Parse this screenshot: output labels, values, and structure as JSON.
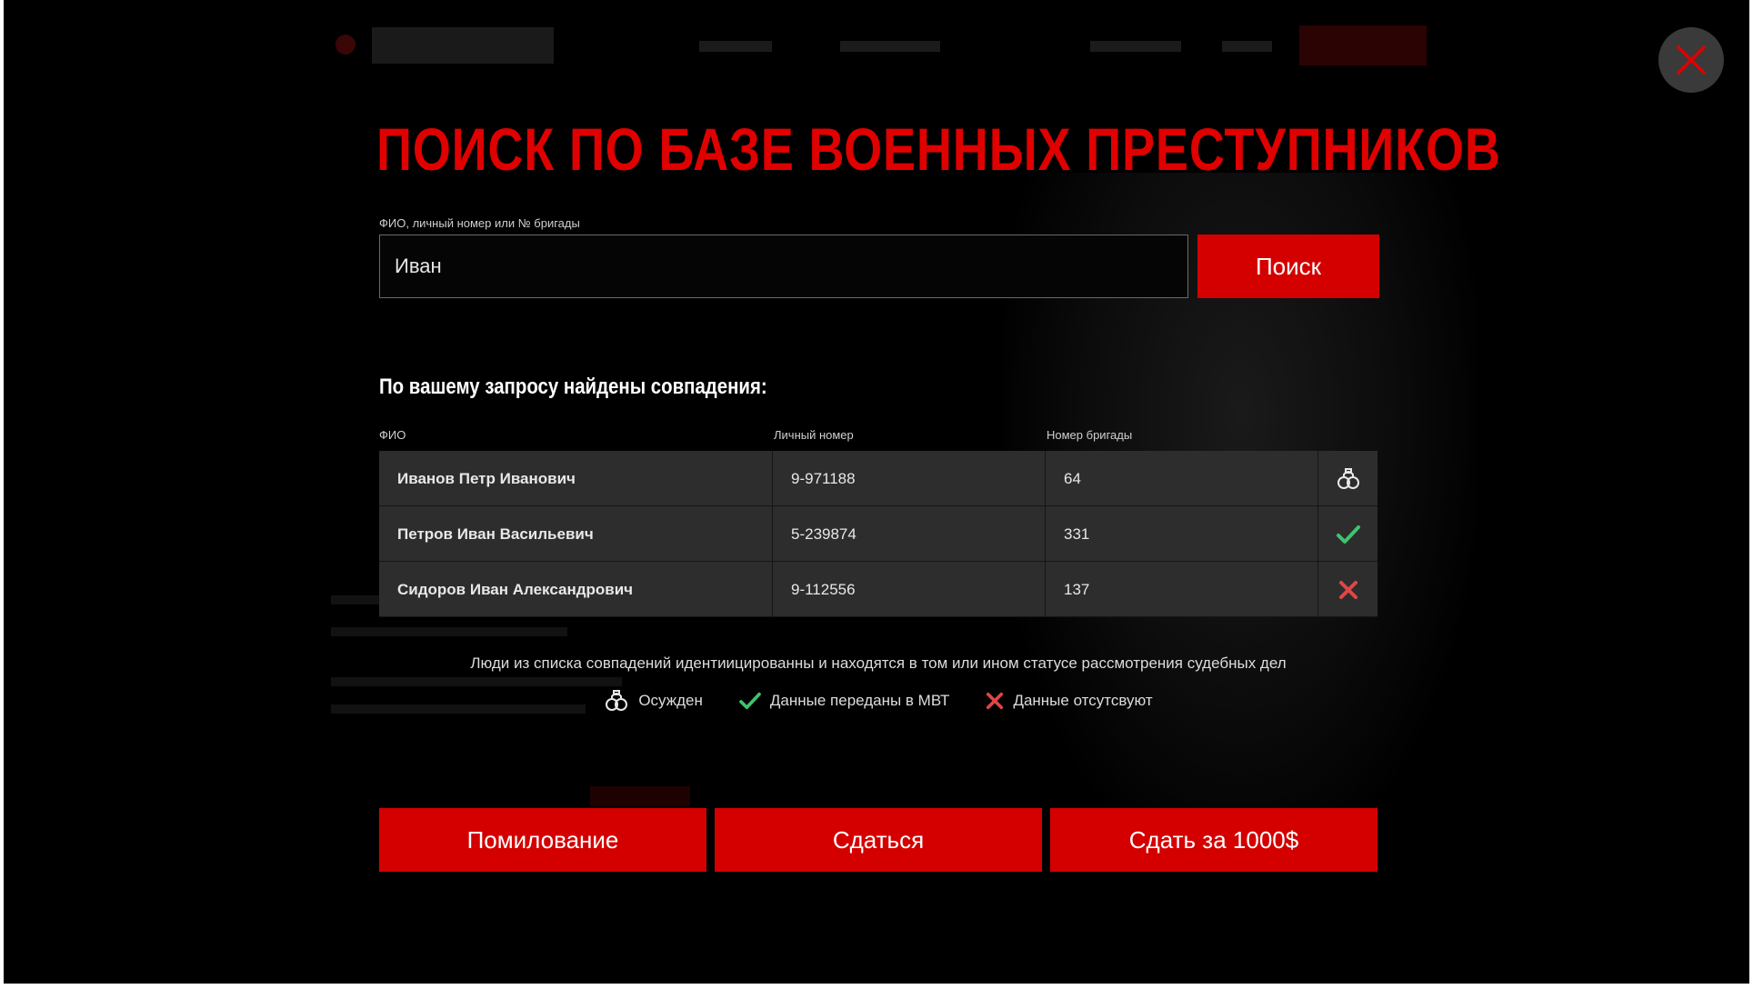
{
  "dialog": {
    "title": "ПОИСК ПО БАЗЕ ВОЕННЫХ ПРЕСТУПНИКОВ",
    "close_icon": "close-icon"
  },
  "search": {
    "label": "ФИО, личный номер или № бригады",
    "value": "Иван",
    "button_label": "Поиск"
  },
  "results": {
    "heading": "По вашему запросу найдены совпадения:",
    "columns": [
      "ФИО",
      "Личный номер",
      "Номер бригады"
    ],
    "rows": [
      {
        "name": "Иванов Петр Иванович",
        "number": "9-971188",
        "brigade": "64",
        "status_icon": "handcuffs-icon"
      },
      {
        "name": "Петров Иван Васильевич",
        "number": "5-239874",
        "brigade": "331",
        "status_icon": "check-icon"
      },
      {
        "name": "Сидоров Иван Александрович",
        "number": "9-112556",
        "brigade": "137",
        "status_icon": "cross-icon"
      }
    ]
  },
  "note": "Люди из списка совпадений идентиицированны и находятся в том или ином статусе рассмотрения судебных дел",
  "legend": [
    {
      "icon": "handcuffs-icon",
      "label": "Осужден"
    },
    {
      "icon": "check-icon",
      "label": "Данные переданы в МВТ"
    },
    {
      "icon": "cross-icon",
      "label": "Данные отсутсвуют"
    }
  ],
  "actions": {
    "pardon_label": "Помилование",
    "surrender_label": "Сдаться",
    "sell_label": "Сдать за 1000$"
  },
  "colors": {
    "accent": "#d40000",
    "title": "#e00000",
    "check": "#3ec46d",
    "cross": "#e04646",
    "row_bg": "#2d2d2d"
  }
}
